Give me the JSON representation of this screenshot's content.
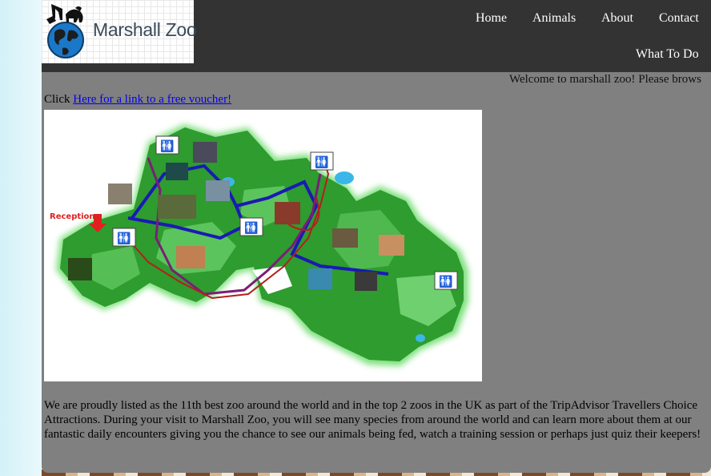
{
  "brand": {
    "name": "Marshall Zoo",
    "logo_blue": "#1b78c8",
    "logo_text_color": "#3a4a5a"
  },
  "nav": {
    "items": [
      {
        "label": "Home"
      },
      {
        "label": "Animals"
      },
      {
        "label": "About"
      },
      {
        "label": "Contact"
      },
      {
        "label": "What To Do"
      }
    ]
  },
  "content": {
    "marquee_text": "Welcome to marshall zoo! Please brows",
    "voucher_prefix": "Click ",
    "voucher_link": "Here for a link to a free voucher!",
    "map_label": "Reception",
    "description": "We are proudly listed as the 11th best zoo around the world and in the top 2 zoos in the UK as part of the TripAdvisor Travellers Choice Attractions. During your visit to Marshall Zoo, you will see many species from around the world and can learn more about them at our fantastic daily encounters giving you the chance to see our animals being fed, watch a training session or perhaps just quiz their keepers!"
  },
  "colors": {
    "header_bg": "#333333",
    "content_bg": "#808080",
    "link": "#0000ee",
    "map_green": "#2e9c2e",
    "path_blue": "#1a1ab4",
    "path_red": "#b41e1e",
    "path_purple": "#7a1e78"
  }
}
